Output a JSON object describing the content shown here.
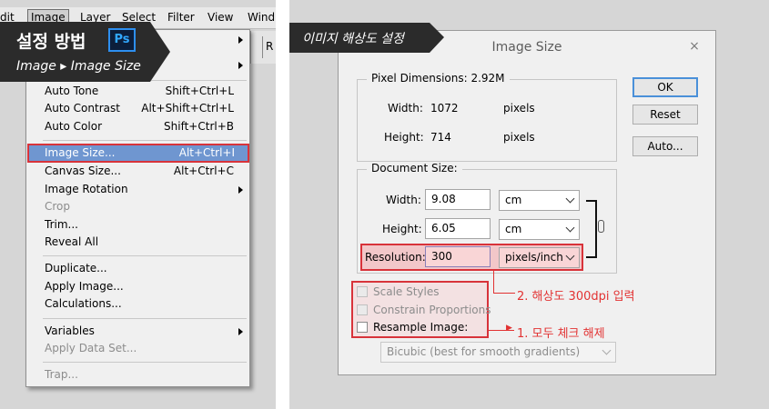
{
  "left": {
    "menubar": [
      "dit",
      "Image",
      "Layer",
      "Select",
      "Filter",
      "View",
      "Wind"
    ],
    "toolbar_text": "R",
    "badge": {
      "title": "설정 방법",
      "ps_icon": "Ps",
      "subtitle": "Image ▸ Image Size"
    },
    "menu": [
      {
        "label": "Auto Tone",
        "shortcut": "Shift+Ctrl+L"
      },
      {
        "label": "Auto Contrast",
        "shortcut": "Alt+Shift+Ctrl+L"
      },
      {
        "label": "Auto Color",
        "shortcut": "Shift+Ctrl+B"
      },
      {
        "label": "Image Size...",
        "shortcut": "Alt+Ctrl+I"
      },
      {
        "label": "Canvas Size...",
        "shortcut": "Alt+Ctrl+C"
      },
      {
        "label": "Image Rotation",
        "shortcut": ""
      },
      {
        "label": "Crop",
        "shortcut": ""
      },
      {
        "label": "Trim...",
        "shortcut": ""
      },
      {
        "label": "Reveal All",
        "shortcut": ""
      },
      {
        "label": "Duplicate...",
        "shortcut": ""
      },
      {
        "label": "Apply Image...",
        "shortcut": ""
      },
      {
        "label": "Calculations...",
        "shortcut": ""
      },
      {
        "label": "Variables",
        "shortcut": ""
      },
      {
        "label": "Apply Data Set...",
        "shortcut": ""
      },
      {
        "label": "Trap...",
        "shortcut": ""
      }
    ]
  },
  "right": {
    "badge": "이미지 해상도 설정",
    "dialog": {
      "title": "Image Size",
      "close": "×",
      "pixel_dimensions": {
        "legend": "Pixel Dimensions:  2.92M",
        "width_label": "Width:",
        "width_value": "1072",
        "width_unit": "pixels",
        "height_label": "Height:",
        "height_value": "714",
        "height_unit": "pixels"
      },
      "document_size": {
        "legend": "Document Size:",
        "width_label": "Width:",
        "width_value": "9.08",
        "width_unit": "cm",
        "height_label": "Height:",
        "height_value": "6.05",
        "height_unit": "cm",
        "resolution_label": "Resolution:",
        "resolution_value": "300",
        "resolution_unit": "pixels/inch"
      },
      "checkboxes": {
        "scale_styles": "Scale Styles",
        "constrain_proportions": "Constrain Proportions",
        "resample_image": "Resample Image:"
      },
      "resample_method": "Bicubic (best for smooth gradients)",
      "buttons": {
        "ok": "OK",
        "reset": "Reset",
        "auto": "Auto..."
      }
    },
    "annotations": {
      "step2": "2. 해상도 300dpi 입력",
      "step1": "1. 모두 체크 해제"
    }
  },
  "colors": {
    "highlight_red": "#d8333a",
    "selection_blue": "#6f96d0",
    "badge_dark": "#2b2b2b",
    "annotation_red": "#e23232"
  }
}
